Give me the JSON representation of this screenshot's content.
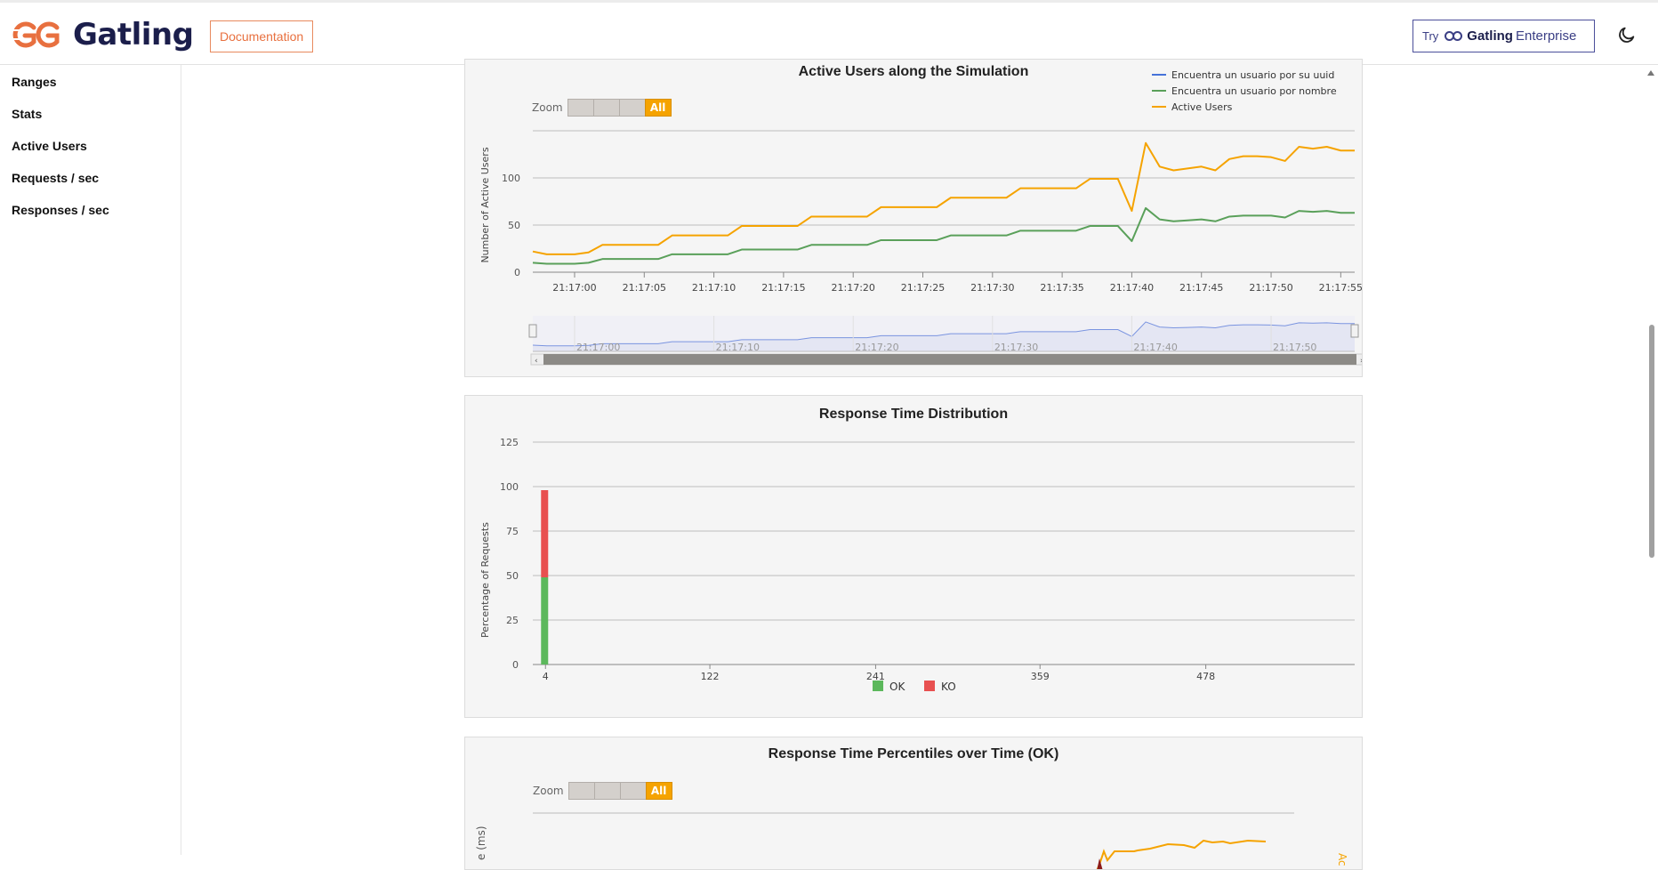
{
  "header": {
    "brand": "Gatling",
    "documentation_label": "Documentation",
    "enterprise": {
      "try": "Try",
      "brand": "Gatling",
      "product": "Enterprise"
    },
    "theme_icon": "moon-icon"
  },
  "sidebar": {
    "items": [
      {
        "label": "Ranges"
      },
      {
        "label": "Stats"
      },
      {
        "label": "Active Users"
      },
      {
        "label": "Requests / sec"
      },
      {
        "label": "Responses / sec"
      }
    ]
  },
  "colors": {
    "accent": "#f5a300",
    "brand_orange": "#e8703f",
    "brand_navy": "#1b1e4b",
    "series_blue": "#4572d9",
    "series_green": "#5aa05a",
    "series_orange": "#f5a300",
    "ok": "#5cb85c",
    "ko": "#e85050"
  },
  "active_users": {
    "title": "Active Users along the Simulation",
    "zoom_label": "Zoom",
    "zoom_all": "All",
    "legend": [
      "Encuentra un usuario por su uuid",
      "Encuentra un usuario por nombre",
      "Active Users"
    ],
    "navigator_ticks": [
      "21:17:00",
      "21:17:10",
      "21:17:20",
      "21:17:30",
      "21:17:40",
      "21:17:50"
    ]
  },
  "response_time_distribution": {
    "title": "Response Time Distribution"
  },
  "percentiles": {
    "title": "Response Time Percentiles over Time (OK)",
    "zoom_label": "Zoom",
    "zoom_all": "All",
    "ylabel_partial": "e (ms)",
    "right_label_partial": "Ac"
  },
  "chart_data": [
    {
      "type": "line",
      "title": "Active Users along the Simulation",
      "xlabel": "",
      "ylabel": "Number of Active Users",
      "ylim": [
        0,
        150
      ],
      "y_ticks": [
        0,
        50,
        100
      ],
      "x_ticks": [
        "21:17:00",
        "21:17:05",
        "21:17:10",
        "21:17:15",
        "21:17:20",
        "21:17:25",
        "21:17:30",
        "21:17:35",
        "21:17:40",
        "21:17:45",
        "21:17:50",
        "21:17:55"
      ],
      "x_range": [
        "21:16:57",
        "21:17:56"
      ],
      "legend_position": "top-right",
      "grid": true,
      "series": [
        {
          "name": "Encuentra un usuario por su uuid",
          "x": [
            "21:16:57",
            "21:17:56"
          ],
          "values": [
            0,
            0
          ]
        },
        {
          "name": "Encuentra un usuario por nombre",
          "x": [
            "21:16:57",
            "21:16:58",
            "21:16:59",
            "21:17:00",
            "21:17:01",
            "21:17:02",
            "21:17:03",
            "21:17:04",
            "21:17:05",
            "21:17:06",
            "21:17:07",
            "21:17:08",
            "21:17:09",
            "21:17:10",
            "21:17:11",
            "21:17:12",
            "21:17:13",
            "21:17:14",
            "21:17:15",
            "21:17:16",
            "21:17:17",
            "21:17:18",
            "21:17:19",
            "21:17:20",
            "21:17:21",
            "21:17:22",
            "21:17:23",
            "21:17:24",
            "21:17:25",
            "21:17:26",
            "21:17:27",
            "21:17:28",
            "21:17:29",
            "21:17:30",
            "21:17:31",
            "21:17:32",
            "21:17:33",
            "21:17:34",
            "21:17:35",
            "21:17:36",
            "21:17:37",
            "21:17:38",
            "21:17:39",
            "21:17:40",
            "21:17:41",
            "21:17:42",
            "21:17:43",
            "21:17:44",
            "21:17:45",
            "21:17:46",
            "21:17:47",
            "21:17:48",
            "21:17:49",
            "21:17:50",
            "21:17:51",
            "21:17:52",
            "21:17:53",
            "21:17:54",
            "21:17:55",
            "21:17:56"
          ],
          "values": [
            10,
            9,
            9,
            9,
            10,
            14,
            14,
            14,
            14,
            14,
            19,
            19,
            19,
            19,
            19,
            24,
            24,
            24,
            24,
            24,
            29,
            29,
            29,
            29,
            29,
            34,
            34,
            34,
            34,
            34,
            39,
            39,
            39,
            39,
            39,
            44,
            44,
            44,
            44,
            44,
            49,
            49,
            49,
            33,
            68,
            56,
            54,
            55,
            56,
            54,
            59,
            60,
            60,
            60,
            58,
            65,
            64,
            65,
            63,
            63
          ]
        },
        {
          "name": "Active Users",
          "x": [
            "21:16:57",
            "21:16:58",
            "21:16:59",
            "21:17:00",
            "21:17:01",
            "21:17:02",
            "21:17:03",
            "21:17:04",
            "21:17:05",
            "21:17:06",
            "21:17:07",
            "21:17:08",
            "21:17:09",
            "21:17:10",
            "21:17:11",
            "21:17:12",
            "21:17:13",
            "21:17:14",
            "21:17:15",
            "21:17:16",
            "21:17:17",
            "21:17:18",
            "21:17:19",
            "21:17:20",
            "21:17:21",
            "21:17:22",
            "21:17:23",
            "21:17:24",
            "21:17:25",
            "21:17:26",
            "21:17:27",
            "21:17:28",
            "21:17:29",
            "21:17:30",
            "21:17:31",
            "21:17:32",
            "21:17:33",
            "21:17:34",
            "21:17:35",
            "21:17:36",
            "21:17:37",
            "21:17:38",
            "21:17:39",
            "21:17:40",
            "21:17:41",
            "21:17:42",
            "21:17:43",
            "21:17:44",
            "21:17:45",
            "21:17:46",
            "21:17:47",
            "21:17:48",
            "21:17:49",
            "21:17:50",
            "21:17:51",
            "21:17:52",
            "21:17:53",
            "21:17:54",
            "21:17:55",
            "21:17:56"
          ],
          "values": [
            22,
            19,
            19,
            19,
            21,
            29,
            29,
            29,
            29,
            29,
            39,
            39,
            39,
            39,
            39,
            49,
            49,
            49,
            49,
            49,
            59,
            59,
            59,
            59,
            59,
            69,
            69,
            69,
            69,
            69,
            79,
            79,
            79,
            79,
            79,
            89,
            89,
            89,
            89,
            89,
            99,
            99,
            99,
            65,
            137,
            112,
            108,
            110,
            112,
            108,
            120,
            123,
            123,
            122,
            118,
            133,
            131,
            133,
            129,
            129
          ]
        }
      ]
    },
    {
      "type": "bar",
      "title": "Response Time Distribution",
      "xlabel": "",
      "ylabel": "Percentage of Requests",
      "ylim": [
        0,
        125
      ],
      "y_ticks": [
        0,
        25,
        50,
        75,
        100,
        125
      ],
      "x_ticks": [
        "4",
        "122",
        "241",
        "359",
        "478"
      ],
      "x_range": [
        0,
        590
      ],
      "stacked": true,
      "grid": true,
      "legend_position": "bottom",
      "categories": [
        "4"
      ],
      "series": [
        {
          "name": "OK",
          "values": [
            49
          ]
        },
        {
          "name": "KO",
          "values": [
            49
          ]
        }
      ]
    }
  ]
}
